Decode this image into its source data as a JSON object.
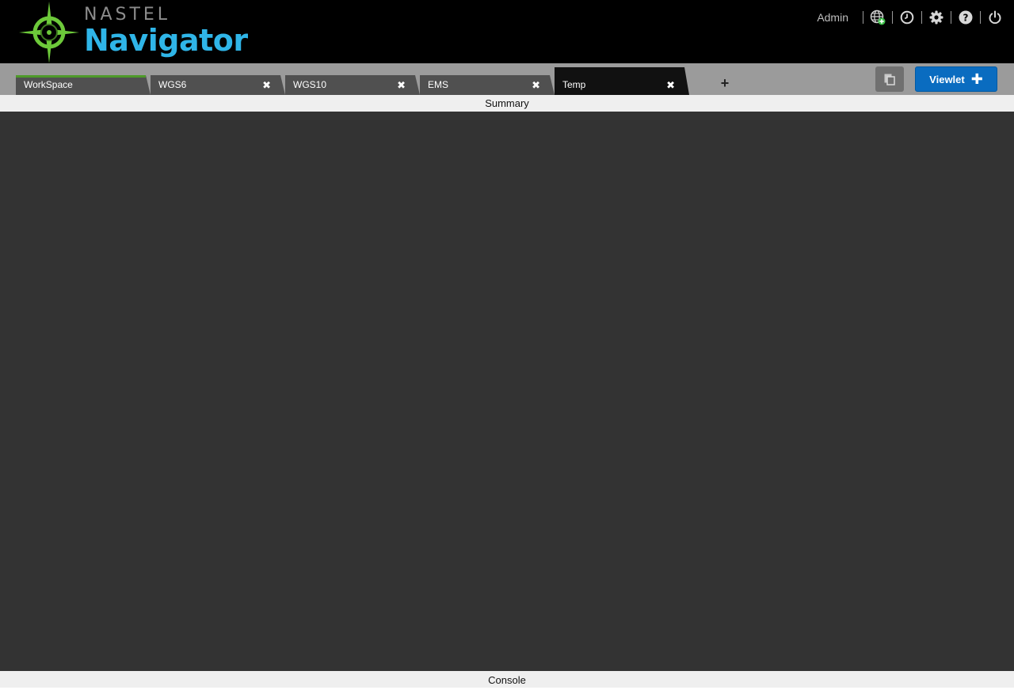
{
  "brand": {
    "top_text": "NASTEL",
    "bottom_text": "Navigator",
    "accent_color": "#2fb5e8",
    "compass_color": "#6dc93a"
  },
  "header": {
    "user_name": "Admin",
    "icons": [
      "globe-add-icon",
      "clock-icon",
      "gear-icon",
      "help-icon",
      "power-icon"
    ]
  },
  "tabs": [
    {
      "label": "WorkSpace",
      "closable": false,
      "active": false
    },
    {
      "label": "WGS6",
      "closable": true,
      "active": false
    },
    {
      "label": "WGS10",
      "closable": true,
      "active": false
    },
    {
      "label": "EMS",
      "closable": true,
      "active": false
    },
    {
      "label": "Temp",
      "closable": true,
      "active": true
    }
  ],
  "toolbar": {
    "add_tab_symbol": "+",
    "viewlet_label": "Viewlet",
    "viewlet_plus": "✚",
    "close_symbol": "✖"
  },
  "panels": {
    "summary_label": "Summary",
    "console_label": "Console"
  }
}
